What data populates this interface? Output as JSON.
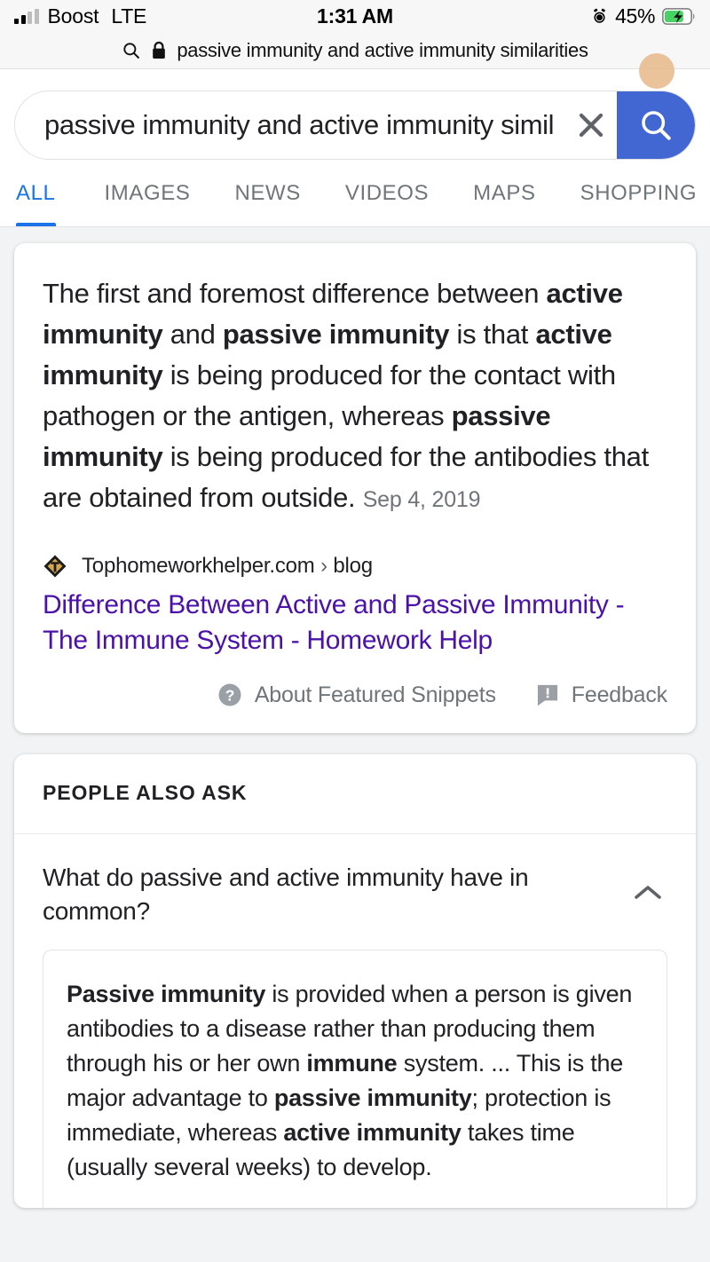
{
  "status_bar": {
    "carrier": "Boost",
    "network": "LTE",
    "time": "1:31 AM",
    "battery_percent": "45%",
    "signal_icon": "signal-bars-icon",
    "alarm_icon": "alarm-clock-icon",
    "battery_icon": "battery-charging-icon"
  },
  "url_bar": {
    "search_icon": "search-icon",
    "lock_icon": "lock-icon",
    "url": "passive immunity and active immunity similarities"
  },
  "search": {
    "value": "passive immunity and active immunity simil",
    "placeholder": "Search",
    "clear_icon": "close-icon",
    "submit_icon": "search-icon",
    "submit_color": "#4267d2"
  },
  "tabs": [
    {
      "label": "ALL",
      "active": true
    },
    {
      "label": "IMAGES",
      "active": false
    },
    {
      "label": "NEWS",
      "active": false
    },
    {
      "label": "VIDEOS",
      "active": false
    },
    {
      "label": "MAPS",
      "active": false
    },
    {
      "label": "SHOPPING",
      "active": false
    }
  ],
  "featured_snippet": {
    "text_parts": [
      {
        "text": "The first and foremost difference between ",
        "bold": false
      },
      {
        "text": "active immunity",
        "bold": true
      },
      {
        "text": " and ",
        "bold": false
      },
      {
        "text": "passive immunity",
        "bold": true
      },
      {
        "text": " is that ",
        "bold": false
      },
      {
        "text": "active immunity",
        "bold": true
      },
      {
        "text": " is being produced for the contact with pathogen or the antigen, whereas ",
        "bold": false
      },
      {
        "text": "passive immunity",
        "bold": true
      },
      {
        "text": " is being produced for the antibodies that are obtained from outside.",
        "bold": false
      }
    ],
    "date": "Sep 4, 2019",
    "favicon": "tophomeworkhelper-diamond-t-icon",
    "source_domain": "Tophomeworkhelper.com",
    "breadcrumb_separator": "›",
    "source_path": "blog",
    "title": "Difference Between Active and Passive Immunity - The Immune System - Homework Help",
    "title_color": "#4b11a8",
    "about_label": "About Featured Snippets",
    "about_icon": "help-circle-icon",
    "feedback_label": "Feedback",
    "feedback_icon": "feedback-flag-icon"
  },
  "people_also_ask": {
    "header": "PEOPLE ALSO ASK",
    "items": [
      {
        "question": "What do passive and active immunity have in common?",
        "expanded": true,
        "chevron_icon": "chevron-up-icon",
        "answer_parts": [
          {
            "text": "Passive immunity",
            "bold": true
          },
          {
            "text": " is provided when a person is given antibodies to a disease rather than producing them through his or her own ",
            "bold": false
          },
          {
            "text": "immune",
            "bold": true
          },
          {
            "text": " system. ... This is the major advantage to ",
            "bold": false
          },
          {
            "text": "passive immunity",
            "bold": true
          },
          {
            "text": "; protection is immediate, whereas ",
            "bold": false
          },
          {
            "text": "active immunity",
            "bold": true
          },
          {
            "text": " takes time (usually several weeks) to develop.",
            "bold": false
          }
        ]
      }
    ]
  }
}
